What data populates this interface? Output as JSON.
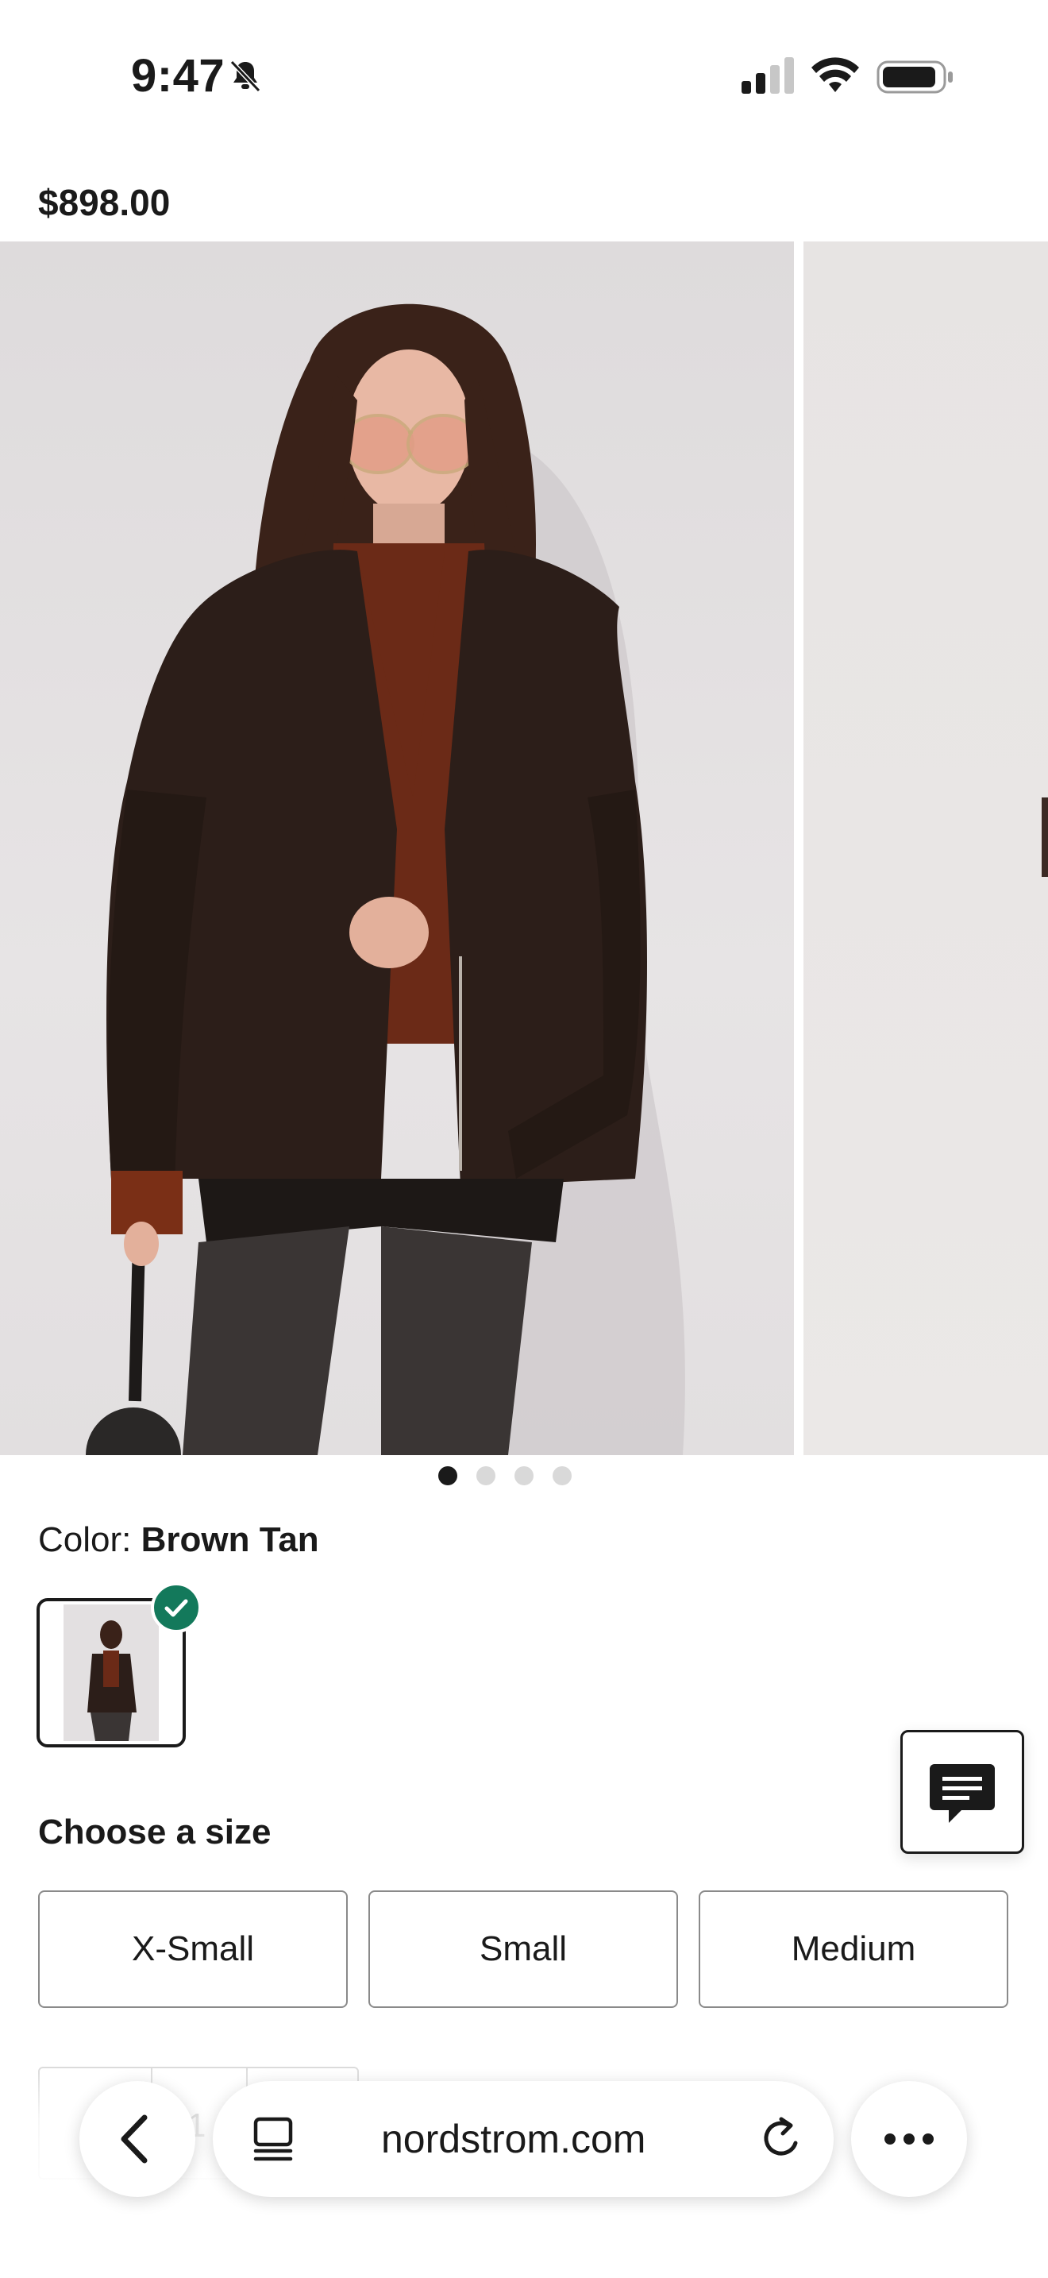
{
  "status_bar": {
    "time": "9:47"
  },
  "product": {
    "price": "$898.00",
    "gallery": {
      "slides": 4,
      "active_slide": 1
    },
    "color": {
      "label": "Color:",
      "value": "Brown Tan"
    },
    "size": {
      "title": "Choose a size",
      "options": [
        "X-Small",
        "Small",
        "Medium"
      ]
    },
    "quantity": {
      "value": "1"
    }
  },
  "browser": {
    "url": "nordstrom.com"
  },
  "colors": {
    "accent_check": "#13795b",
    "text": "#1a1a1a"
  },
  "icons": [
    "bell-slash-icon",
    "signal-icon",
    "wifi-icon",
    "battery-icon",
    "check-icon",
    "chat-icon",
    "back-chevron-icon",
    "tabs-icon",
    "reload-icon",
    "more-icon"
  ]
}
